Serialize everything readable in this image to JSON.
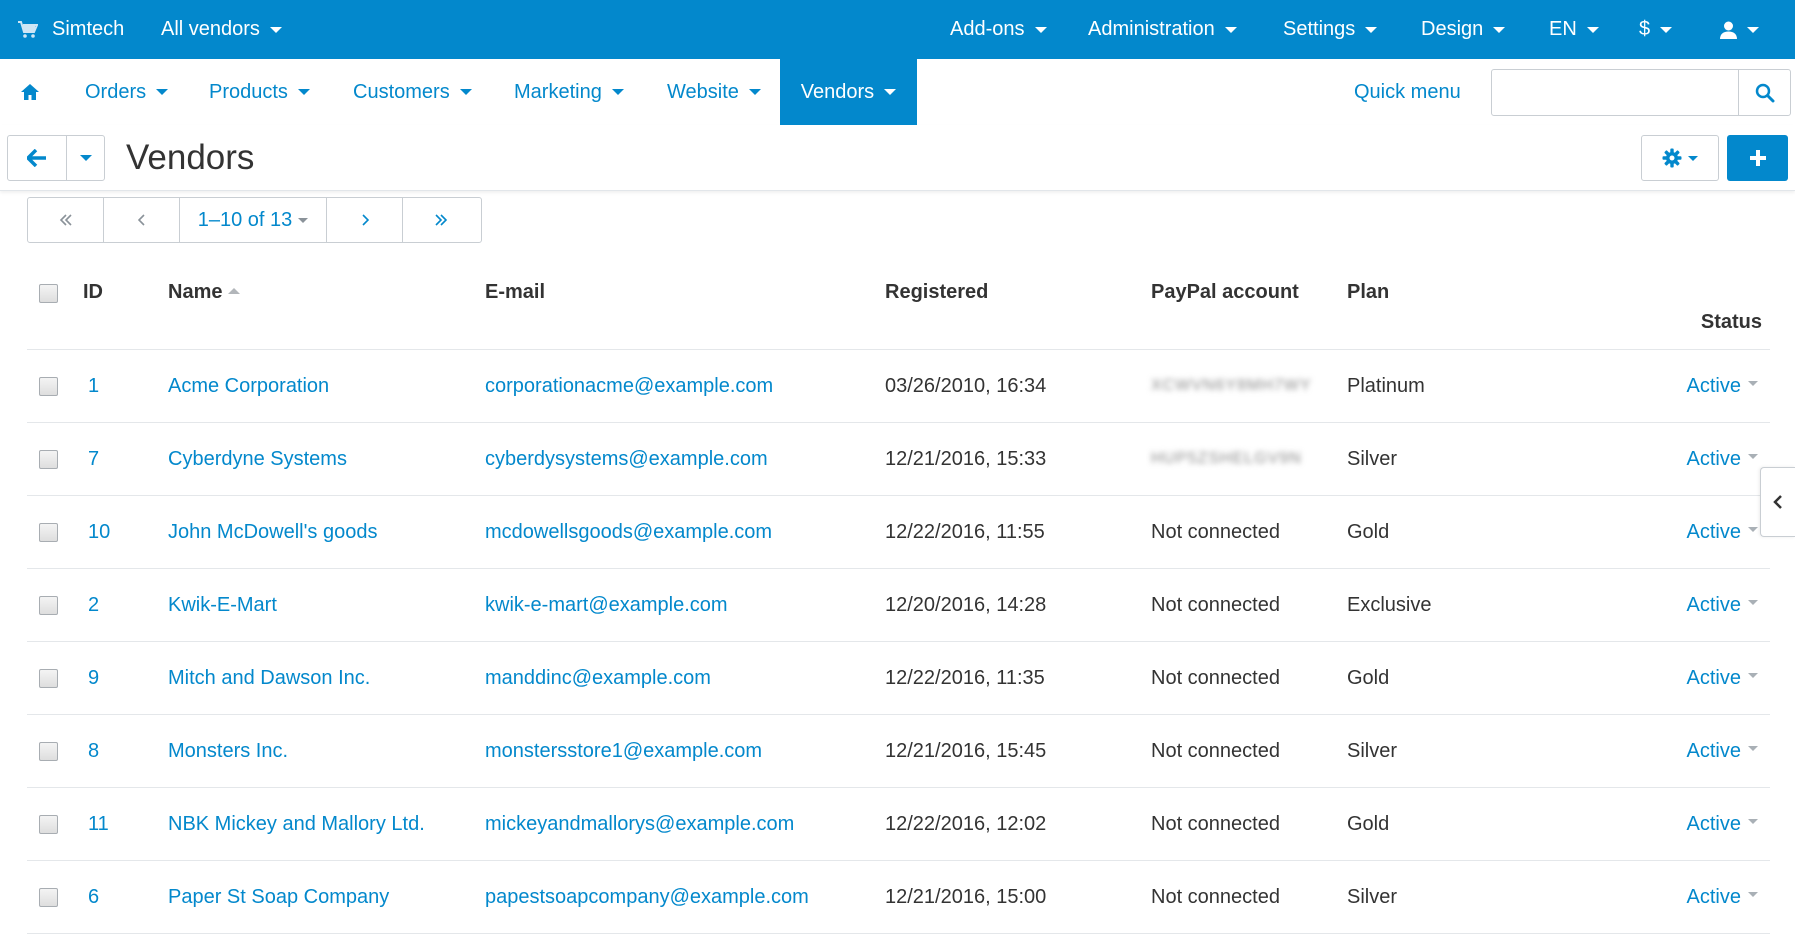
{
  "colors": {
    "primary": "#0388cc",
    "text": "#333333",
    "border": "#c9ced3"
  },
  "topbar": {
    "store_name": "Simtech",
    "vendor_selector": "All vendors",
    "menu": [
      "Add-ons",
      "Administration",
      "Settings",
      "Design"
    ],
    "language": "EN",
    "currency": "$"
  },
  "nav": {
    "items": [
      "Orders",
      "Products",
      "Customers",
      "Marketing",
      "Website",
      "Vendors"
    ],
    "active": "Vendors",
    "quick_menu": "Quick menu",
    "search": {
      "value": "",
      "placeholder": ""
    }
  },
  "page": {
    "title": "Vendors"
  },
  "pagination": {
    "range": "1–10 of 13"
  },
  "table": {
    "headers": {
      "id": "ID",
      "name": "Name",
      "email": "E-mail",
      "registered": "Registered",
      "paypal": "PayPal account",
      "plan": "Plan",
      "status": "Status"
    },
    "rows": [
      {
        "id": "1",
        "name": "Acme Corporation",
        "email": "corporationacme@example.com",
        "registered": "03/26/2010, 16:34",
        "paypal": "XCWVN6Y8MH7WY",
        "paypal_blurred": true,
        "plan": "Platinum",
        "status": "Active"
      },
      {
        "id": "7",
        "name": "Cyberdyne Systems",
        "email": "cyberdysystems@example.com",
        "registered": "12/21/2016, 15:33",
        "paypal": "HUP5ZSHELGV9N",
        "paypal_blurred": true,
        "plan": "Silver",
        "status": "Active"
      },
      {
        "id": "10",
        "name": "John McDowell's goods",
        "email": "mcdowellsgoods@example.com",
        "registered": "12/22/2016, 11:55",
        "paypal": "Not connected",
        "paypal_blurred": false,
        "plan": "Gold",
        "status": "Active"
      },
      {
        "id": "2",
        "name": "Kwik-E-Mart",
        "email": "kwik-e-mart@example.com",
        "registered": "12/20/2016, 14:28",
        "paypal": "Not connected",
        "paypal_blurred": false,
        "plan": "Exclusive",
        "status": "Active"
      },
      {
        "id": "9",
        "name": "Mitch and Dawson Inc.",
        "email": "manddinc@example.com",
        "registered": "12/22/2016, 11:35",
        "paypal": "Not connected",
        "paypal_blurred": false,
        "plan": "Gold",
        "status": "Active"
      },
      {
        "id": "8",
        "name": "Monsters Inc.",
        "email": "monstersstore1@example.com",
        "registered": "12/21/2016, 15:45",
        "paypal": "Not connected",
        "paypal_blurred": false,
        "plan": "Silver",
        "status": "Active"
      },
      {
        "id": "11",
        "name": "NBK Mickey and Mallory Ltd.",
        "email": "mickeyandmallorys@example.com",
        "registered": "12/22/2016, 12:02",
        "paypal": "Not connected",
        "paypal_blurred": false,
        "plan": "Gold",
        "status": "Active"
      },
      {
        "id": "6",
        "name": "Paper St Soap Company",
        "email": "papestsoapcompany@example.com",
        "registered": "12/21/2016, 15:00",
        "paypal": "Not connected",
        "paypal_blurred": false,
        "plan": "Silver",
        "status": "Active"
      }
    ]
  },
  "icons": [
    "cart-icon",
    "home-icon",
    "search-icon",
    "arrow-left-icon",
    "gear-icon",
    "plus-icon",
    "user-icon",
    "chevron-left-icon"
  ]
}
